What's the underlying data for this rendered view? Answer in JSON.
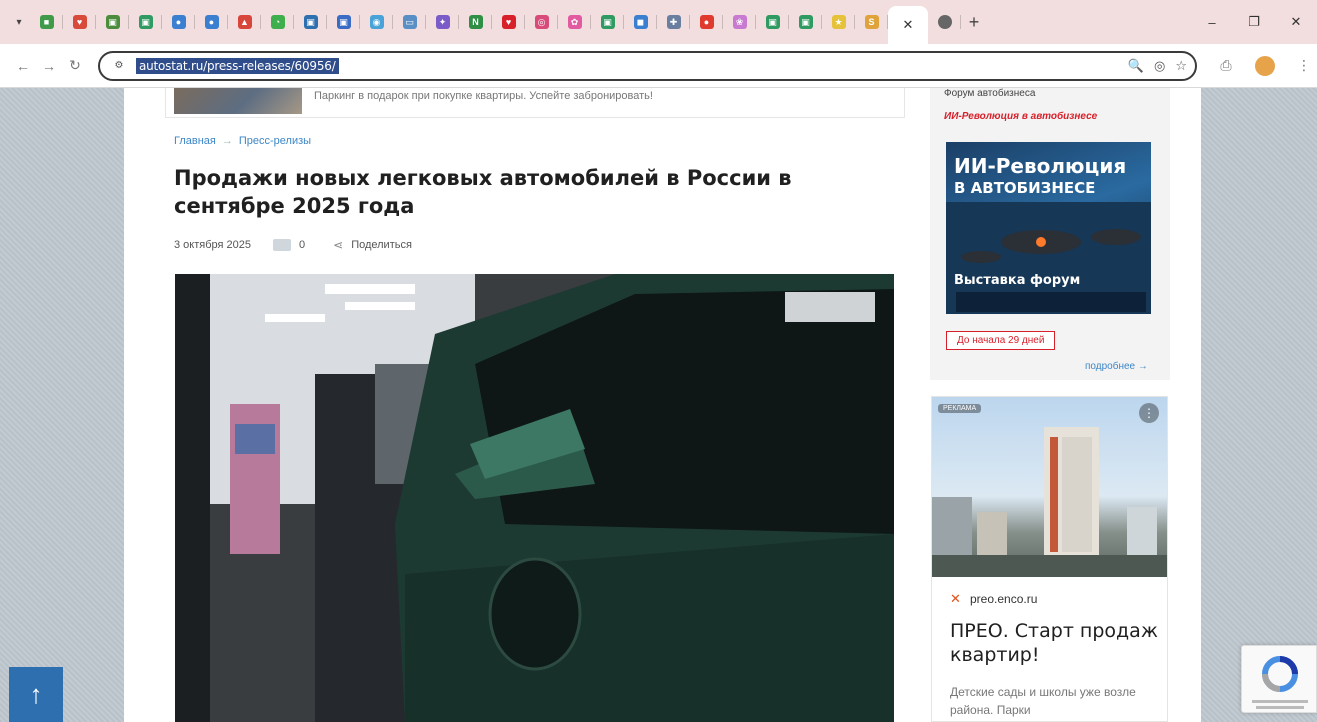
{
  "browser": {
    "tab_icons": [
      {
        "name": "tab-1",
        "color": "#3f9a4a",
        "glyph": "■"
      },
      {
        "name": "tab-2",
        "color": "#d84a3a",
        "glyph": "♥"
      },
      {
        "name": "tab-3",
        "color": "#4c8c3c",
        "glyph": "▣"
      },
      {
        "name": "tab-4",
        "color": "#2f9a62",
        "glyph": "▣"
      },
      {
        "name": "tab-5",
        "color": "#3b7fd0",
        "glyph": "●"
      },
      {
        "name": "tab-6",
        "color": "#3b7fd0",
        "glyph": "●"
      },
      {
        "name": "tab-7",
        "color": "#d8453a",
        "glyph": "▲"
      },
      {
        "name": "tab-8",
        "color": "#3fae4d",
        "glyph": "◔"
      },
      {
        "name": "tab-9",
        "color": "#2e6fb0",
        "glyph": "▣"
      },
      {
        "name": "tab-10",
        "color": "#3a6cc5",
        "glyph": "▣"
      },
      {
        "name": "tab-11",
        "color": "#4aa3d8",
        "glyph": "◉"
      },
      {
        "name": "tab-12",
        "color": "#5a8fc5",
        "glyph": "▭"
      },
      {
        "name": "tab-13",
        "color": "#7a5bc7",
        "glyph": "✦"
      },
      {
        "name": "tab-14",
        "color": "#2f8f44",
        "glyph": "N"
      },
      {
        "name": "tab-15",
        "color": "#d8202a",
        "glyph": "♥"
      },
      {
        "name": "tab-16",
        "color": "#d84a7a",
        "glyph": "◎"
      },
      {
        "name": "tab-17",
        "color": "#e25aa0",
        "glyph": "✿"
      },
      {
        "name": "tab-18",
        "color": "#2f9a62",
        "glyph": "▣"
      },
      {
        "name": "tab-19",
        "color": "#3b7fd0",
        "glyph": "◼"
      },
      {
        "name": "tab-20",
        "color": "#6a7fa0",
        "glyph": "✚"
      },
      {
        "name": "tab-21",
        "color": "#e0392e",
        "glyph": "●"
      },
      {
        "name": "tab-22",
        "color": "#c77ad0",
        "glyph": "❀"
      },
      {
        "name": "tab-23",
        "color": "#2f9a62",
        "glyph": "▣"
      },
      {
        "name": "tab-24",
        "color": "#2f9a62",
        "glyph": "▣"
      },
      {
        "name": "tab-25",
        "color": "#e6c23a",
        "glyph": "★"
      },
      {
        "name": "tab-26",
        "color": "#e0a23a",
        "glyph": "S"
      }
    ],
    "active_tab_icon": "close-icon",
    "url": "autostat.ru/press-releases/60956/"
  },
  "page": {
    "promo_text": "Паркинг в подарок при покупке квартиры. Успейте забронировать!",
    "breadcrumb": {
      "home": "Главная",
      "sep": "→",
      "section": "Пресс-релизы"
    },
    "headline": "Продажи новых легковых автомобилей в России в сентябре 2025 года",
    "date": "3 октября 2025",
    "comments": "0",
    "share": "Поделиться"
  },
  "sidebar": {
    "top_text": "Форум автобизнеса",
    "event_title": "ИИ-Революция в автобизнесе",
    "banner_title": "ИИ-Революция",
    "banner_sub": "В АВТОБИЗНЕСЕ",
    "banner_foot": "Выставка форум",
    "countdown": "До начала 29 дней",
    "more": "подробнее →"
  },
  "ad": {
    "label": "РЕКЛАМА",
    "domain": "preo.enco.ru",
    "title": "ПРЕО. Старт продаж квартир!",
    "desc": "Детские сады и школы уже возле района. Парки"
  }
}
